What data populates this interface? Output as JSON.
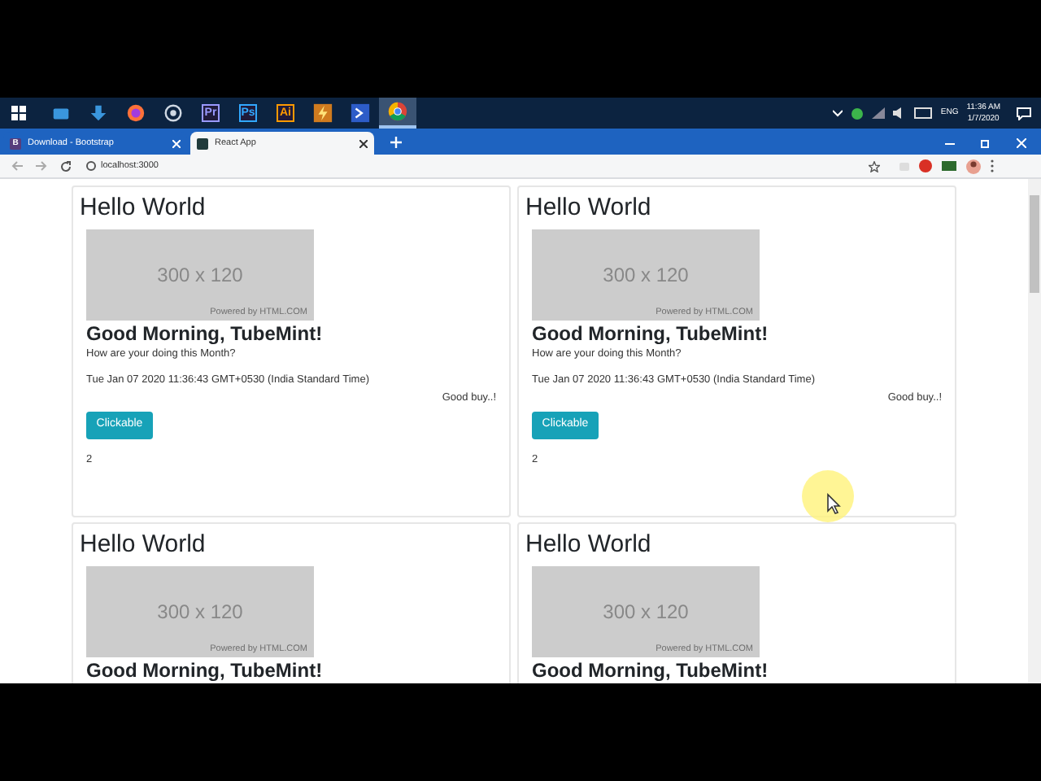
{
  "taskbar": {
    "apps": [
      {
        "kind": "monitor",
        "selected": false
      },
      {
        "kind": "download",
        "selected": false
      },
      {
        "kind": "fox",
        "selected": false
      },
      {
        "kind": "ring",
        "selected": false
      },
      {
        "kind": "letter",
        "label": "Pr",
        "color": "#9999ff",
        "selected": false
      },
      {
        "kind": "letter",
        "label": "Ps",
        "color": "#31a8ff",
        "selected": false
      },
      {
        "kind": "letter",
        "label": "Ai",
        "color": "#ff9a00",
        "selected": false
      },
      {
        "kind": "bolt",
        "selected": false
      },
      {
        "kind": "shell",
        "selected": false
      },
      {
        "kind": "chrome",
        "selected": true
      }
    ],
    "tray": {
      "language": "ENG",
      "time": "11:36 AM",
      "date": "1/7/2020"
    }
  },
  "browser": {
    "tabs": [
      {
        "title": "Download - Bootstrap",
        "icon": "B",
        "selected": false
      },
      {
        "title": "React App",
        "selected": true
      }
    ],
    "address": "localhost:3000"
  },
  "cards": [
    {
      "heading": "Hello World",
      "image_text": "300 x 120",
      "image_credit": "Powered by HTML.COM",
      "greeting": "Good Morning, TubeMint!",
      "question": "How are your doing this Month?",
      "date": "Tue Jan 07 2020 11:36:43 GMT+0530 (India Standard Time)",
      "farewell": "Good buy..!",
      "button": "Clickable",
      "count": "2"
    },
    {
      "heading": "Hello World",
      "image_text": "300 x 120",
      "image_credit": "Powered by HTML.COM",
      "greeting": "Good Morning, TubeMint!",
      "question": "How are your doing this Month?",
      "date": "Tue Jan 07 2020 11:36:43 GMT+0530 (India Standard Time)",
      "farewell": "Good buy..!",
      "button": "Clickable",
      "count": "2"
    },
    {
      "heading": "Hello World",
      "image_text": "300 x 120",
      "image_credit": "Powered by HTML.COM",
      "greeting": "Good Morning, TubeMint!"
    },
    {
      "heading": "Hello World",
      "image_text": "300 x 120",
      "image_credit": "Powered by HTML.COM",
      "greeting": "Good Morning, TubeMint!"
    }
  ]
}
